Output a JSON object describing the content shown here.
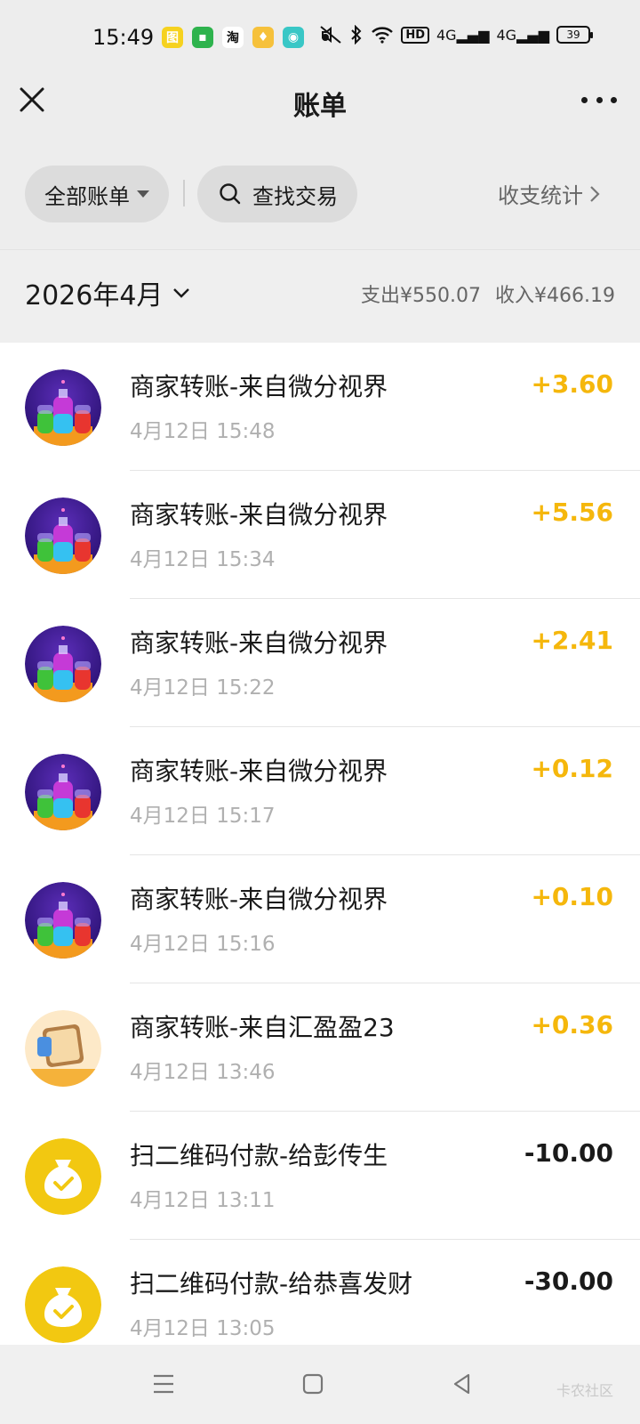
{
  "status_bar": {
    "time": "15:49",
    "apps": [
      {
        "icon": "photo-app-icon",
        "glyph": "图",
        "color": "#f6d21f"
      },
      {
        "icon": "message-app-icon",
        "glyph": "▪",
        "color": "#2eb34d"
      },
      {
        "icon": "taobao-app-icon",
        "glyph": "淘",
        "color": "#ffffff"
      },
      {
        "icon": "vip-app-icon",
        "glyph": "♦",
        "color": "#f6c13b"
      },
      {
        "icon": "chat-app-icon",
        "glyph": "◉",
        "color": "#39c7c6"
      }
    ],
    "hd_label": "HD",
    "net1": "4G",
    "net2": "4G",
    "battery": "39"
  },
  "nav": {
    "title": "账单"
  },
  "filters": {
    "all_bills": "全部账单",
    "search": "查找交易",
    "stats": "收支统计"
  },
  "month_bar": {
    "month": "2026年4月",
    "expense": "支出¥550.07",
    "income": "收入¥466.19"
  },
  "transactions": [
    {
      "title": "商家转账-来自微分视界",
      "time": "4月12日 15:48",
      "amount": "+3.60",
      "type": "income",
      "avatar": "bottles-avatar"
    },
    {
      "title": "商家转账-来自微分视界",
      "time": "4月12日 15:34",
      "amount": "+5.56",
      "type": "income",
      "avatar": "bottles-avatar"
    },
    {
      "title": "商家转账-来自微分视界",
      "time": "4月12日 15:22",
      "amount": "+2.41",
      "type": "income",
      "avatar": "bottles-avatar"
    },
    {
      "title": "商家转账-来自微分视界",
      "time": "4月12日 15:17",
      "amount": "+0.12",
      "type": "income",
      "avatar": "bottles-avatar"
    },
    {
      "title": "商家转账-来自微分视界",
      "time": "4月12日 15:16",
      "amount": "+0.10",
      "type": "income",
      "avatar": "bottles-avatar"
    },
    {
      "title": "商家转账-来自汇盈盈23",
      "time": "4月12日 13:46",
      "amount": "+0.36",
      "type": "income",
      "avatar": "quiz-avatar"
    },
    {
      "title": "扫二维码付款-给彭传生",
      "time": "4月12日 13:11",
      "amount": "-10.00",
      "type": "expense",
      "avatar": "money-bag-avatar"
    },
    {
      "title": "扫二维码付款-给恭喜发财",
      "time": "4月12日 13:05",
      "amount": "-30.00",
      "type": "expense",
      "avatar": "money-bag-avatar"
    }
  ],
  "colors": {
    "income": "#f5b70c",
    "expense": "#1a1a1a",
    "pay_yellow": "#f2c811"
  },
  "watermark": "卡农社区"
}
